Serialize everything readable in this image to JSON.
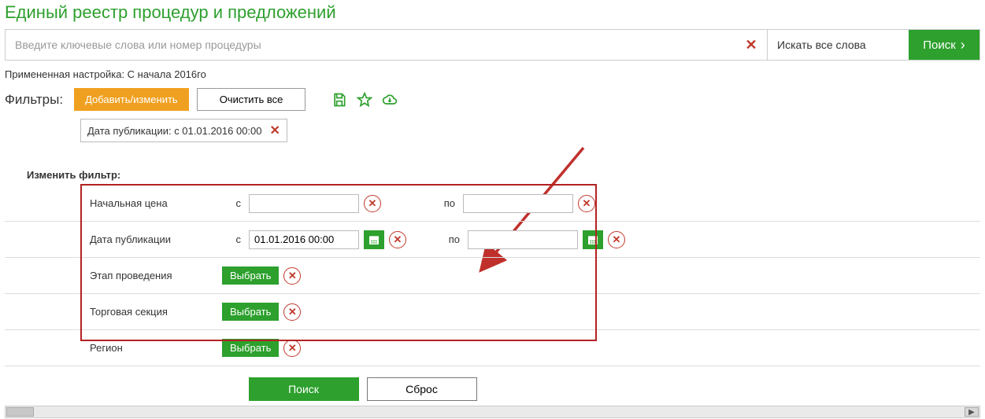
{
  "title": "Единый реестр процедур и предложений",
  "search": {
    "placeholder": "Введите ключевые слова или номер процедуры",
    "mode_label": "Искать все слова",
    "button_label": "Поиск"
  },
  "applied_line": "Примененная настройка: С начала 2016го",
  "filters": {
    "label": "Фильтры:",
    "add_edit": "Добавить/изменить",
    "clear_all": "Очистить все",
    "chip_text": "Дата публикации: с 01.01.2016 00:00"
  },
  "change_filter_label": "Изменить фильтр:",
  "filter_rows": {
    "start_price": {
      "label": "Начальная цена",
      "from_label": "с",
      "to_label": "по",
      "from_val": "",
      "to_val": ""
    },
    "pub_date": {
      "label": "Дата публикации",
      "from_label": "с",
      "to_label": "по",
      "from_val": "01.01.2016 00:00",
      "to_val": ""
    },
    "stage": {
      "label": "Этап проведения",
      "select_label": "Выбрать"
    },
    "trade_section": {
      "label": "Торговая секция",
      "select_label": "Выбрать"
    },
    "region": {
      "label": "Регион",
      "select_label": "Выбрать"
    }
  },
  "bottom": {
    "search": "Поиск",
    "reset": "Сброс"
  }
}
